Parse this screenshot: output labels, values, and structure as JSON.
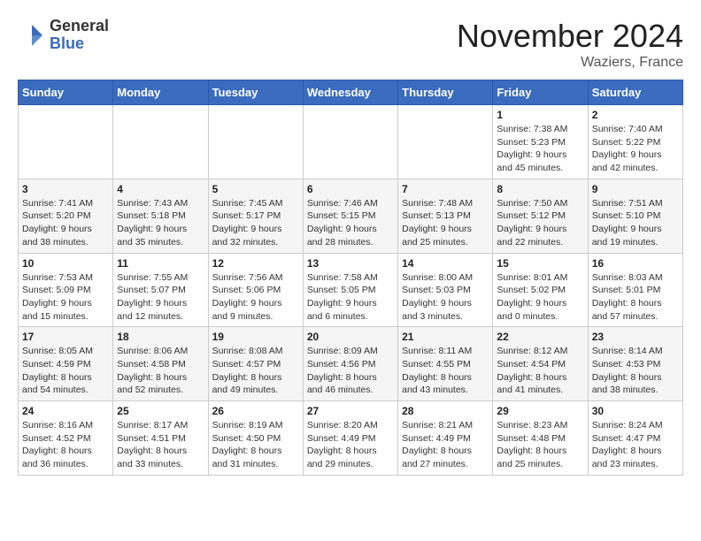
{
  "header": {
    "logo_general": "General",
    "logo_blue": "Blue",
    "month_title": "November 2024",
    "location": "Waziers, France"
  },
  "days_of_week": [
    "Sunday",
    "Monday",
    "Tuesday",
    "Wednesday",
    "Thursday",
    "Friday",
    "Saturday"
  ],
  "weeks": [
    [
      {
        "day": "",
        "info": ""
      },
      {
        "day": "",
        "info": ""
      },
      {
        "day": "",
        "info": ""
      },
      {
        "day": "",
        "info": ""
      },
      {
        "day": "",
        "info": ""
      },
      {
        "day": "1",
        "info": "Sunrise: 7:38 AM\nSunset: 5:23 PM\nDaylight: 9 hours and 45 minutes."
      },
      {
        "day": "2",
        "info": "Sunrise: 7:40 AM\nSunset: 5:22 PM\nDaylight: 9 hours and 42 minutes."
      }
    ],
    [
      {
        "day": "3",
        "info": "Sunrise: 7:41 AM\nSunset: 5:20 PM\nDaylight: 9 hours and 38 minutes."
      },
      {
        "day": "4",
        "info": "Sunrise: 7:43 AM\nSunset: 5:18 PM\nDaylight: 9 hours and 35 minutes."
      },
      {
        "day": "5",
        "info": "Sunrise: 7:45 AM\nSunset: 5:17 PM\nDaylight: 9 hours and 32 minutes."
      },
      {
        "day": "6",
        "info": "Sunrise: 7:46 AM\nSunset: 5:15 PM\nDaylight: 9 hours and 28 minutes."
      },
      {
        "day": "7",
        "info": "Sunrise: 7:48 AM\nSunset: 5:13 PM\nDaylight: 9 hours and 25 minutes."
      },
      {
        "day": "8",
        "info": "Sunrise: 7:50 AM\nSunset: 5:12 PM\nDaylight: 9 hours and 22 minutes."
      },
      {
        "day": "9",
        "info": "Sunrise: 7:51 AM\nSunset: 5:10 PM\nDaylight: 9 hours and 19 minutes."
      }
    ],
    [
      {
        "day": "10",
        "info": "Sunrise: 7:53 AM\nSunset: 5:09 PM\nDaylight: 9 hours and 15 minutes."
      },
      {
        "day": "11",
        "info": "Sunrise: 7:55 AM\nSunset: 5:07 PM\nDaylight: 9 hours and 12 minutes."
      },
      {
        "day": "12",
        "info": "Sunrise: 7:56 AM\nSunset: 5:06 PM\nDaylight: 9 hours and 9 minutes."
      },
      {
        "day": "13",
        "info": "Sunrise: 7:58 AM\nSunset: 5:05 PM\nDaylight: 9 hours and 6 minutes."
      },
      {
        "day": "14",
        "info": "Sunrise: 8:00 AM\nSunset: 5:03 PM\nDaylight: 9 hours and 3 minutes."
      },
      {
        "day": "15",
        "info": "Sunrise: 8:01 AM\nSunset: 5:02 PM\nDaylight: 9 hours and 0 minutes."
      },
      {
        "day": "16",
        "info": "Sunrise: 8:03 AM\nSunset: 5:01 PM\nDaylight: 8 hours and 57 minutes."
      }
    ],
    [
      {
        "day": "17",
        "info": "Sunrise: 8:05 AM\nSunset: 4:59 PM\nDaylight: 8 hours and 54 minutes."
      },
      {
        "day": "18",
        "info": "Sunrise: 8:06 AM\nSunset: 4:58 PM\nDaylight: 8 hours and 52 minutes."
      },
      {
        "day": "19",
        "info": "Sunrise: 8:08 AM\nSunset: 4:57 PM\nDaylight: 8 hours and 49 minutes."
      },
      {
        "day": "20",
        "info": "Sunrise: 8:09 AM\nSunset: 4:56 PM\nDaylight: 8 hours and 46 minutes."
      },
      {
        "day": "21",
        "info": "Sunrise: 8:11 AM\nSunset: 4:55 PM\nDaylight: 8 hours and 43 minutes."
      },
      {
        "day": "22",
        "info": "Sunrise: 8:12 AM\nSunset: 4:54 PM\nDaylight: 8 hours and 41 minutes."
      },
      {
        "day": "23",
        "info": "Sunrise: 8:14 AM\nSunset: 4:53 PM\nDaylight: 8 hours and 38 minutes."
      }
    ],
    [
      {
        "day": "24",
        "info": "Sunrise: 8:16 AM\nSunset: 4:52 PM\nDaylight: 8 hours and 36 minutes."
      },
      {
        "day": "25",
        "info": "Sunrise: 8:17 AM\nSunset: 4:51 PM\nDaylight: 8 hours and 33 minutes."
      },
      {
        "day": "26",
        "info": "Sunrise: 8:19 AM\nSunset: 4:50 PM\nDaylight: 8 hours and 31 minutes."
      },
      {
        "day": "27",
        "info": "Sunrise: 8:20 AM\nSunset: 4:49 PM\nDaylight: 8 hours and 29 minutes."
      },
      {
        "day": "28",
        "info": "Sunrise: 8:21 AM\nSunset: 4:49 PM\nDaylight: 8 hours and 27 minutes."
      },
      {
        "day": "29",
        "info": "Sunrise: 8:23 AM\nSunset: 4:48 PM\nDaylight: 8 hours and 25 minutes."
      },
      {
        "day": "30",
        "info": "Sunrise: 8:24 AM\nSunset: 4:47 PM\nDaylight: 8 hours and 23 minutes."
      }
    ]
  ]
}
